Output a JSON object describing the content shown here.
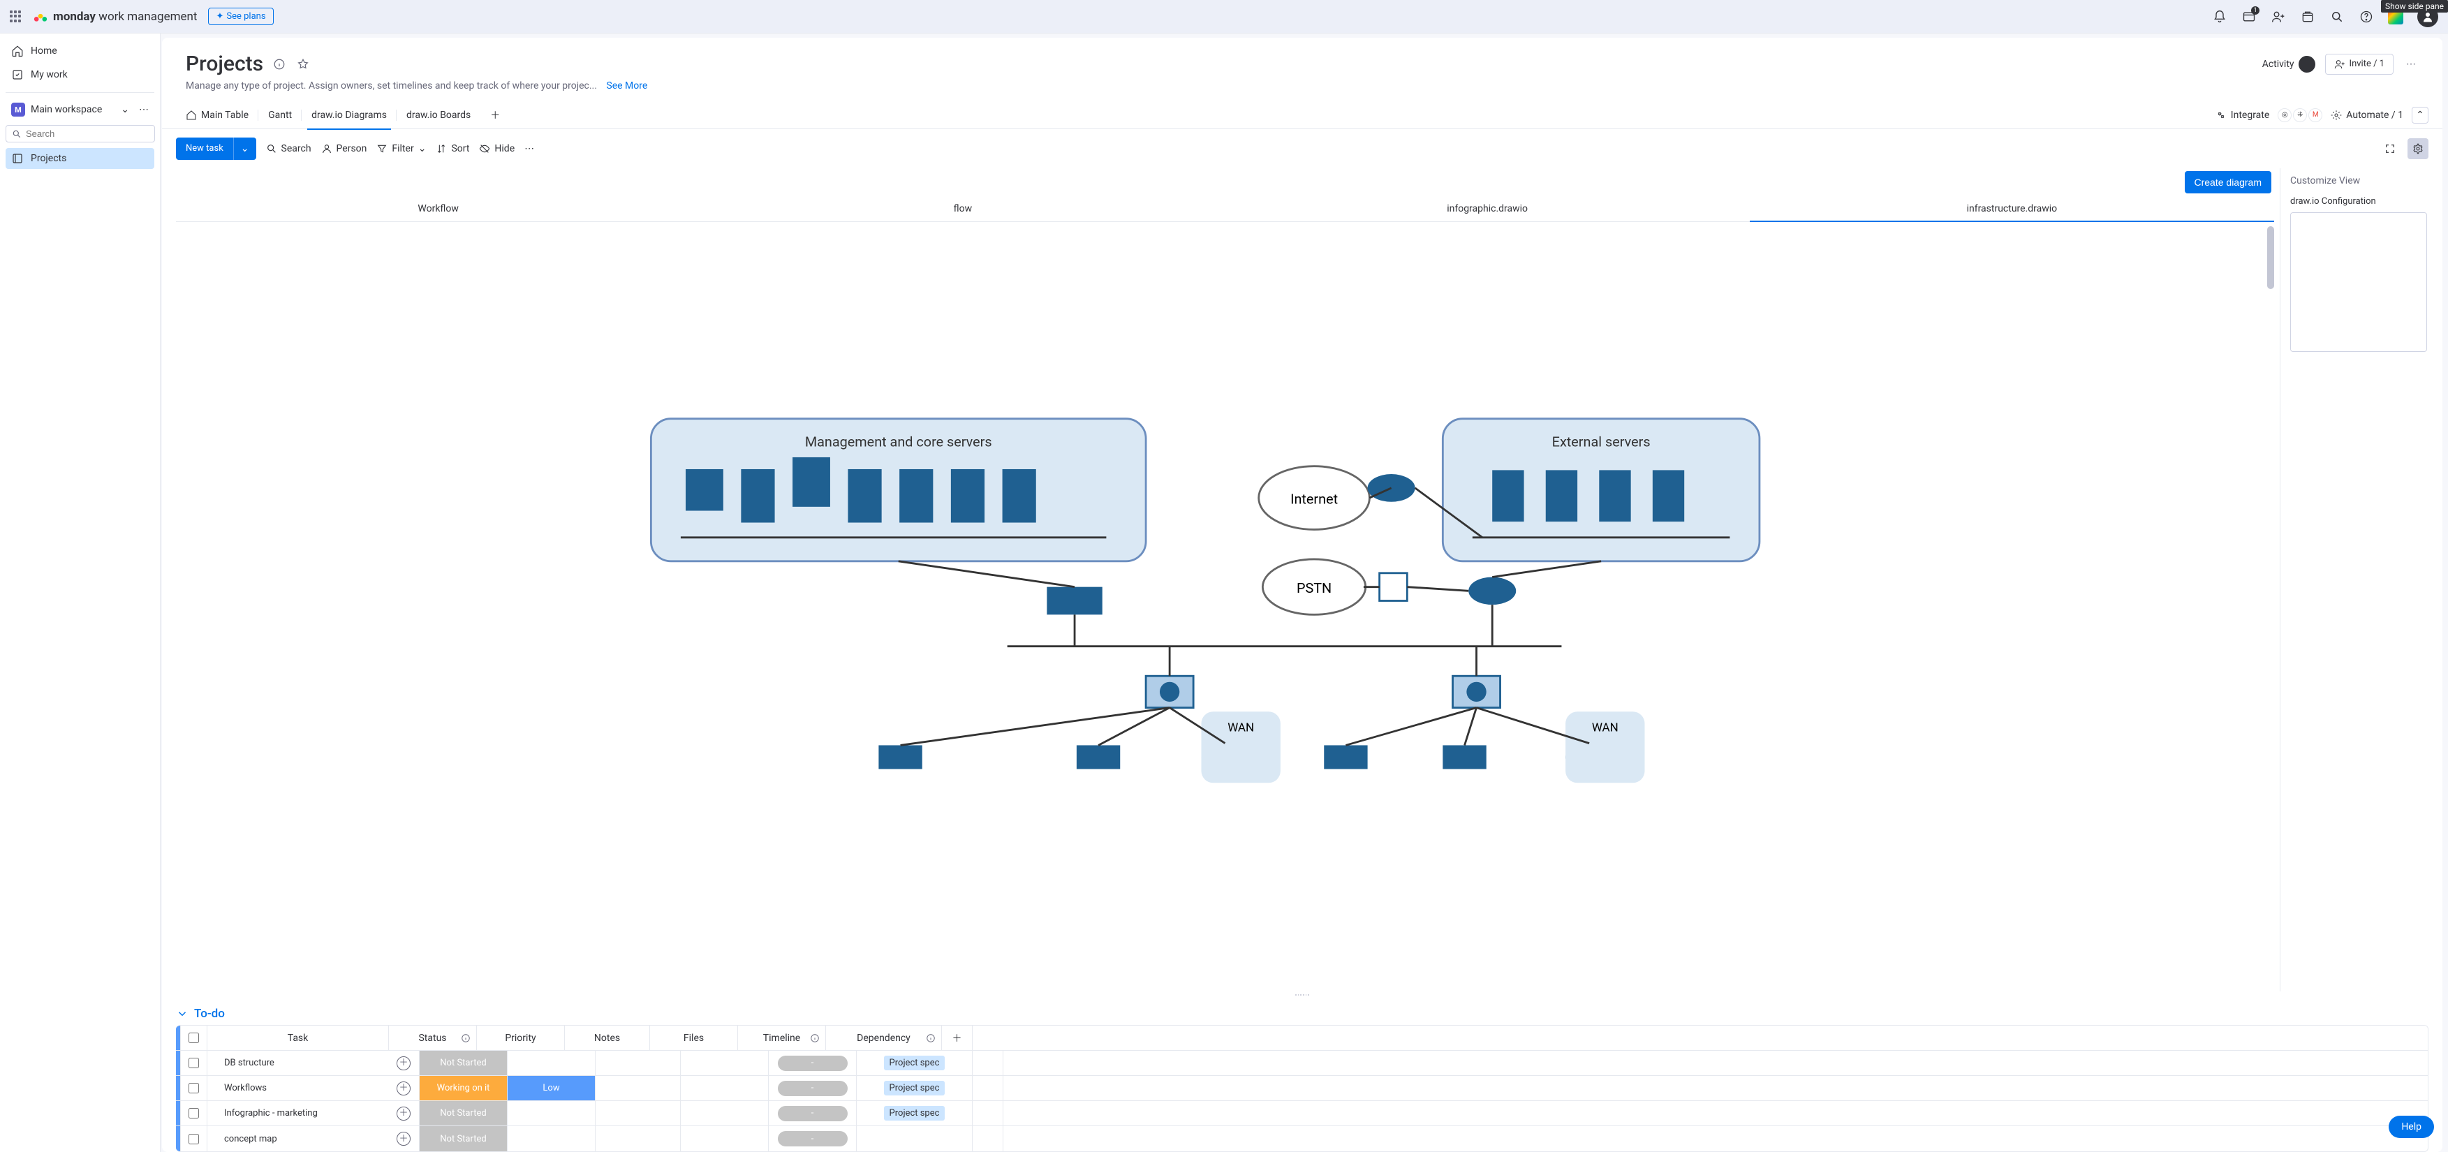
{
  "tooltip": "Show side pane",
  "topbar": {
    "brand_bold": "monday",
    "brand_rest": " work management",
    "see_plans": "See plans",
    "inbox_badge": "1"
  },
  "leftnav": {
    "home": "Home",
    "mywork": "My work",
    "workspace_initial": "M",
    "workspace": "Main workspace",
    "search_ph": "Search",
    "board": "Projects"
  },
  "header": {
    "title": "Projects",
    "subtitle": "Manage any type of project. Assign owners, set timelines and keep track of where your projec...",
    "see_more": "See More",
    "activity": "Activity",
    "invite": "Invite / 1"
  },
  "tabs": {
    "main": "Main Table",
    "gantt": "Gantt",
    "diagrams": "draw.io Diagrams",
    "boards": "draw.io Boards",
    "integrate": "Integrate",
    "automate": "Automate / 1"
  },
  "toolbar": {
    "newtask": "New task",
    "search": "Search",
    "person": "Person",
    "filter": "Filter",
    "sort": "Sort",
    "hide": "Hide"
  },
  "diagram": {
    "create": "Create diagram",
    "tabs": [
      "Workflow",
      "flow",
      "infographic.drawio",
      "infrastructure.drawio"
    ],
    "box_mgmt": "Management and core servers",
    "box_ext": "External servers",
    "internet": "Internet",
    "pstn": "PSTN",
    "wan": "WAN"
  },
  "sidepanel": {
    "title": "Customize View",
    "config": "draw.io Configuration"
  },
  "group": {
    "title": "To-do",
    "cols": {
      "task": "Task",
      "status": "Status",
      "priority": "Priority",
      "notes": "Notes",
      "files": "Files",
      "timeline": "Timeline",
      "dependency": "Dependency"
    },
    "rows": [
      {
        "task": "DB structure",
        "status": "Not Started",
        "status_cls": "status-notstarted",
        "priority": "",
        "prio_cls": "",
        "timeline": "-",
        "dep": "Project spec"
      },
      {
        "task": "Workflows",
        "status": "Working on it",
        "status_cls": "status-working",
        "priority": "Low",
        "prio_cls": "prio-low",
        "timeline": "-",
        "dep": "Project spec"
      },
      {
        "task": "Infographic - marketing",
        "status": "Not Started",
        "status_cls": "status-notstarted",
        "priority": "",
        "prio_cls": "",
        "timeline": "-",
        "dep": "Project spec"
      },
      {
        "task": "concept map",
        "status": "Not Started",
        "status_cls": "status-notstarted",
        "priority": "",
        "prio_cls": "",
        "timeline": "-",
        "dep": ""
      }
    ]
  },
  "help": "Help"
}
